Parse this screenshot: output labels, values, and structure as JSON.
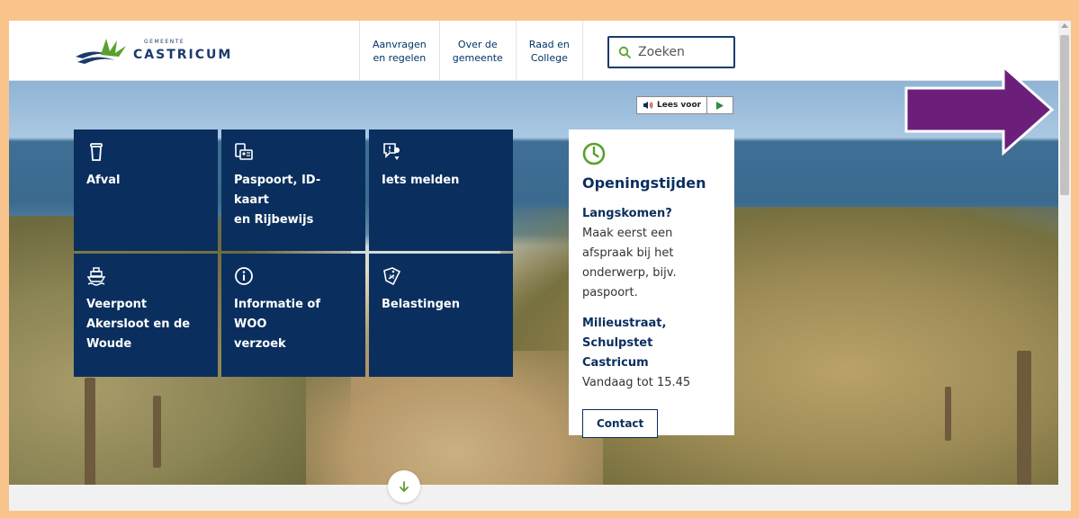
{
  "logo": {
    "small_text": "GEMEENTE",
    "word": "CASTRICUM"
  },
  "nav": {
    "items": [
      {
        "label": "Aanvragen\nen regelen"
      },
      {
        "label": "Over de\ngemeente"
      },
      {
        "label": "Raad en\nCollege"
      }
    ]
  },
  "search": {
    "placeholder": "Zoeken"
  },
  "readspeaker": {
    "label": "Lees voor"
  },
  "tiles": [
    {
      "label": "Afval",
      "icon": "waste-bin-icon"
    },
    {
      "label": "Paspoort, ID-kaart\nen Rijbewijs",
      "icon": "id-card-icon"
    },
    {
      "label": "Iets melden",
      "icon": "report-location-icon"
    },
    {
      "label": "Veerpont\nAkersloot en de\nWoude",
      "icon": "ferry-icon"
    },
    {
      "label": "Informatie of WOO\nverzoek",
      "icon": "info-icon"
    },
    {
      "label": "Belastingen",
      "icon": "tax-tag-icon"
    }
  ],
  "hours": {
    "title": "Openingstijden",
    "visit_title": "Langskomen?",
    "visit_text": "Maak eerst een afspraak bij het onderwerp, bijv. paspoort.",
    "location_title": "Milieustraat, Schulpstet Castricum",
    "location_text": "Vandaag tot 15.45",
    "contact_label": "Contact"
  },
  "colors": {
    "brand_navy": "#0a2f5e",
    "accent_green": "#5aa02c",
    "frame_orange": "#f8c48c",
    "annotation_purple": "#6b1f7a"
  }
}
